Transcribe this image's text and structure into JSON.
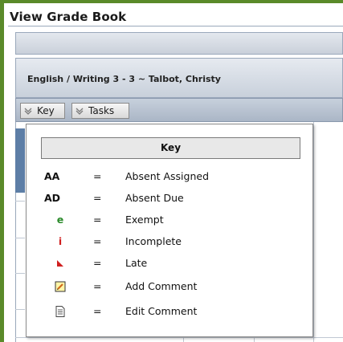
{
  "page": {
    "title": "View Grade Book"
  },
  "course": {
    "title": "English / Writing 3 - 3 ~ Talbot, Christy"
  },
  "toolbar": {
    "key_label": "Key",
    "tasks_label": "Tasks"
  },
  "key_popup": {
    "header": "Key",
    "equals": "=",
    "rows": [
      {
        "symbol": "AA",
        "icon": "",
        "description": "Absent Assigned"
      },
      {
        "symbol": "AD",
        "icon": "",
        "description": "Absent Due"
      },
      {
        "symbol": "e",
        "icon": "",
        "description": "Exempt",
        "color": "#2a8a2a"
      },
      {
        "symbol": "i",
        "icon": "",
        "description": "Incomplete",
        "color": "#d02020"
      },
      {
        "symbol": "",
        "icon": "late-flag-icon",
        "description": "Late",
        "color": "#d02020"
      },
      {
        "symbol": "",
        "icon": "add-comment-icon",
        "description": "Add Comment"
      },
      {
        "symbol": "",
        "icon": "edit-comment-icon",
        "description": "Edit Comment"
      }
    ]
  },
  "colors": {
    "accent_green": "#5a8a2a",
    "header_blue": "#5d7ea6",
    "toolbar_blue": "#aab6c6"
  }
}
